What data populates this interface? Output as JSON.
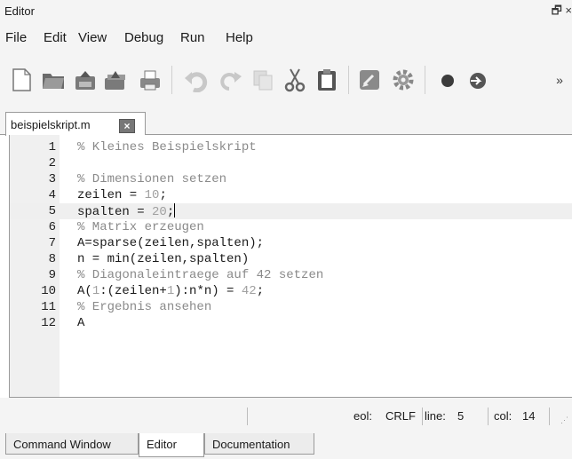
{
  "window": {
    "title": "Editor",
    "controls": "🗗 ×"
  },
  "menu": [
    "File",
    "Edit",
    "View",
    "Debug",
    "Run",
    "Help"
  ],
  "toolbar": {
    "icons": [
      "new-file-icon",
      "open-folder-icon",
      "save-icon",
      "save-all-icon",
      "print-icon",
      "undo-icon",
      "redo-icon",
      "copy-icon",
      "cut-icon",
      "paste-icon",
      "comment-icon",
      "settings-icon",
      "breakpoint-icon",
      "step-icon"
    ],
    "overflow": "»"
  },
  "tab": {
    "name": "beispielskript.m",
    "close": "×"
  },
  "editor": {
    "current_line": 5,
    "lines": [
      {
        "n": "1",
        "parts": [
          [
            "cm",
            "% Kleines Beispielskript"
          ]
        ]
      },
      {
        "n": "2",
        "parts": []
      },
      {
        "n": "3",
        "parts": [
          [
            "cm",
            "% Dimensionen setzen"
          ]
        ]
      },
      {
        "n": "4",
        "parts": [
          [
            "tx",
            "zeilen = "
          ],
          [
            "num",
            "10"
          ],
          [
            "tx",
            ";"
          ]
        ]
      },
      {
        "n": "5",
        "parts": [
          [
            "tx",
            "spalten = "
          ],
          [
            "num",
            "20"
          ],
          [
            "tx",
            ";"
          ]
        ]
      },
      {
        "n": "6",
        "parts": [
          [
            "cm",
            "% Matrix erzeugen"
          ]
        ]
      },
      {
        "n": "7",
        "parts": [
          [
            "tx",
            "A=sparse(zeilen,spalten);"
          ]
        ]
      },
      {
        "n": "8",
        "parts": [
          [
            "tx",
            "n = min(zeilen,spalten)"
          ]
        ]
      },
      {
        "n": "9",
        "parts": [
          [
            "cm",
            "% Diagonaleintraege auf 42 setzen"
          ]
        ]
      },
      {
        "n": "10",
        "parts": [
          [
            "tx",
            "A("
          ],
          [
            "num",
            "1"
          ],
          [
            "tx",
            ":(zeilen+"
          ],
          [
            "num",
            "1"
          ],
          [
            "tx",
            "):n*n) = "
          ],
          [
            "num",
            "42"
          ],
          [
            "tx",
            ";"
          ]
        ]
      },
      {
        "n": "11",
        "parts": [
          [
            "cm",
            "% Ergebnis ansehen"
          ]
        ]
      },
      {
        "n": "12",
        "parts": [
          [
            "tx",
            "A"
          ]
        ]
      }
    ]
  },
  "status": {
    "eol_label": "eol:",
    "eol_value": "CRLF",
    "line_label": "line:",
    "line_value": "5",
    "col_label": "col:",
    "col_value": "14"
  },
  "bottom_tabs": [
    "Command Window",
    "Editor",
    "Documentation"
  ],
  "active_bottom_tab": 1,
  "colors": {
    "comment": "#8a8a8a",
    "number": "#a0a0a0",
    "chrome": "#f4f4f4",
    "gutter": "#f0f0f0"
  }
}
